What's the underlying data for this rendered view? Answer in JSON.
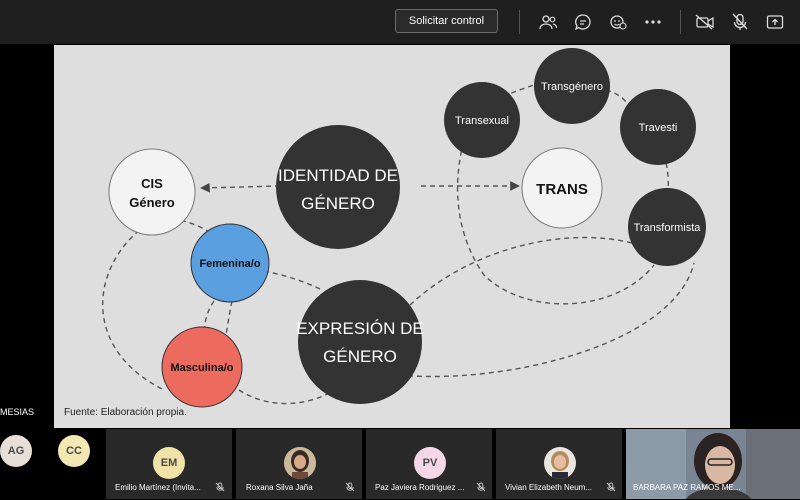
{
  "toolbar": {
    "request_control_label": "Solicitar control",
    "icons": [
      "participants-icon",
      "chat-icon",
      "reactions-icon",
      "more-icon",
      "camera-off-icon",
      "mic-off-icon",
      "share-icon"
    ]
  },
  "slide": {
    "nodes": {
      "identidad": [
        "IDENTIDAD DE",
        "GÉNERO"
      ],
      "expresion": [
        "EXPRESIÓN DE",
        "GÉNERO"
      ],
      "cis": [
        "CIS",
        "Género"
      ],
      "femenina": "Femenina/o",
      "masculina": "Masculina/o",
      "trans": "TRANS",
      "transexual": "Transexual",
      "transgenero": "Transgénero",
      "travesti": "Travesti",
      "transformista": "Transformista"
    },
    "source": "Fuente: Elaboración propia.",
    "colors": {
      "dark": "#333333",
      "white": "#f3f3f3",
      "blue": "#5a9fe0",
      "red": "#ec6a5e",
      "background": "#dedede"
    }
  },
  "left_label": "MESIAS",
  "participants": [
    {
      "initials": "AG",
      "color": "#e8e0d8"
    },
    {
      "initials": "CC",
      "color": "#f3e7b3"
    },
    {
      "initials": "EM",
      "color": "#f1e3a8",
      "name": "Emilio Martínez (Invita..."
    },
    {
      "name": "Roxana Silva Jaña"
    },
    {
      "initials": "PV",
      "color": "#f6d7e8",
      "name": "Paz Javiera Rodriguez ..."
    },
    {
      "name": "Vivian Elizabeth Neum..."
    },
    {
      "name": "BARBARA PAZ RAMOS ME..."
    }
  ]
}
